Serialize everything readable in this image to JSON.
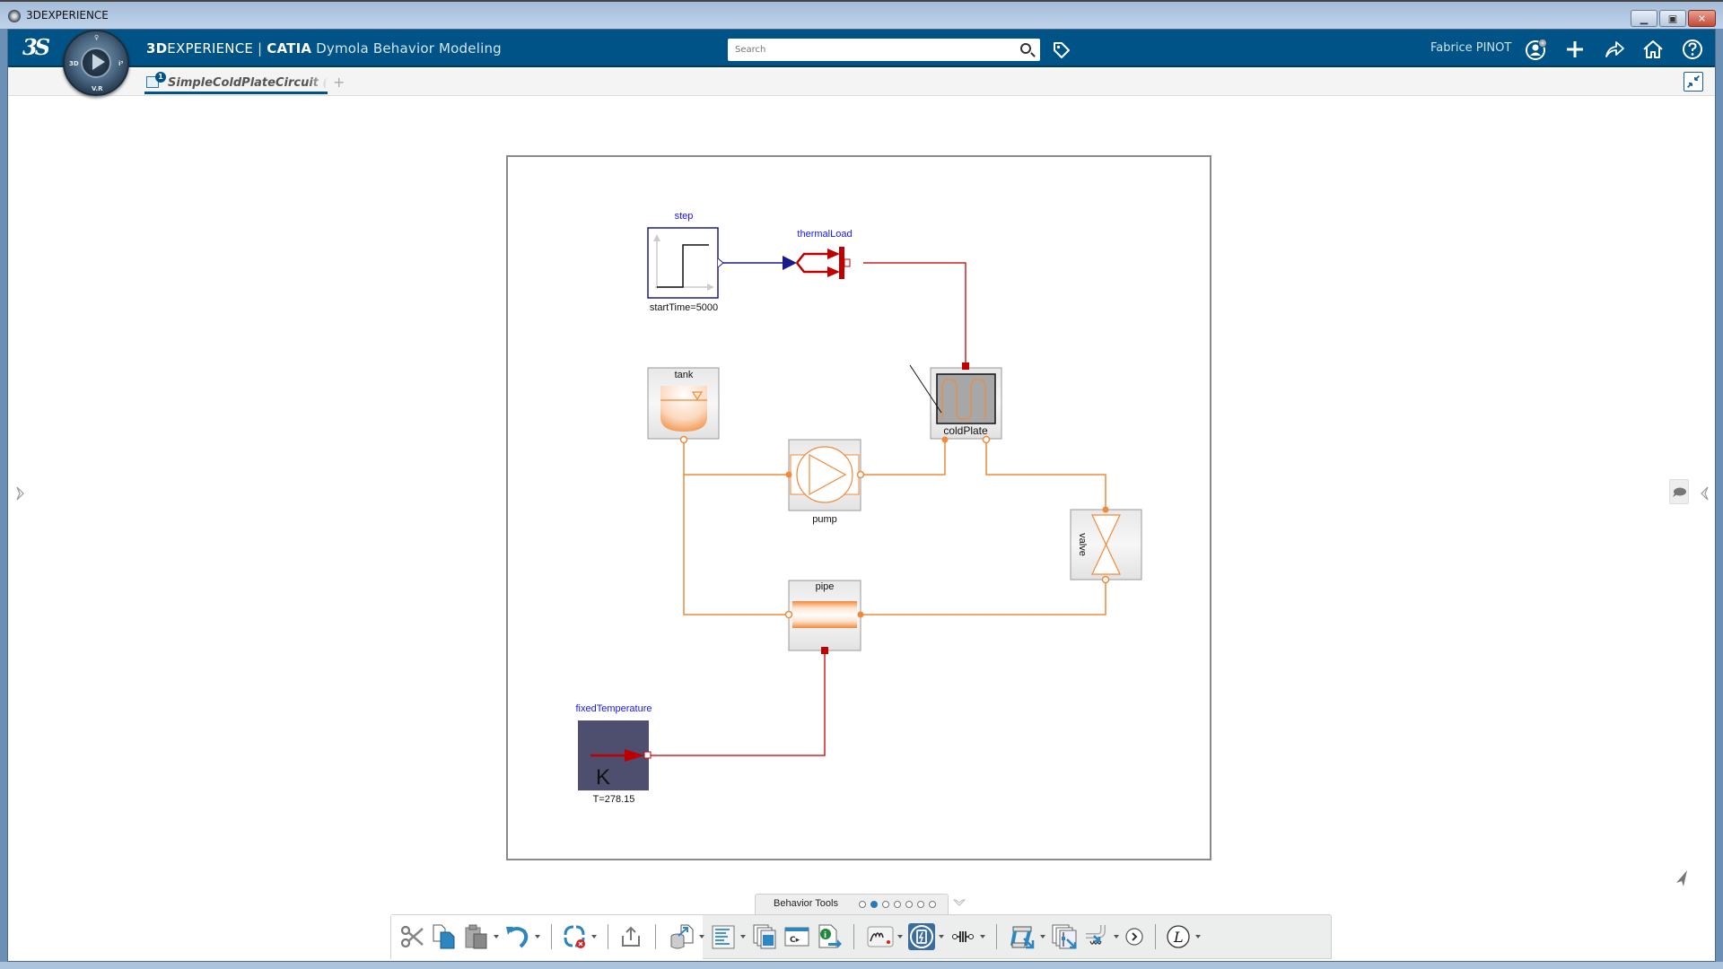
{
  "window": {
    "title": "3DEXPERIENCE",
    "controls": [
      "minimize",
      "maximize",
      "close"
    ]
  },
  "header": {
    "brand_bold": "3D",
    "brand_light": "EXPERIENCE",
    "separator": " | ",
    "product": "CATIA",
    "app_name": "Dymola Behavior Modeling",
    "compass_labels": {
      "top": "♀",
      "left": "3D",
      "right": "i³",
      "bottom": "V.R"
    },
    "search": {
      "placeholder": "Search",
      "value": ""
    },
    "user_name": "Fabrice PINOT",
    "icons": [
      "tag-icon",
      "user-icon",
      "add-icon",
      "share-icon",
      "home-icon",
      "help-icon"
    ]
  },
  "tabs": {
    "active": {
      "label": "SimpleColdPlateCircuit (Enc",
      "badge": "1"
    },
    "add_label": "+"
  },
  "diagram": {
    "components": [
      {
        "id": "step",
        "name": "step",
        "param": "startTime=5000",
        "type": "step-source"
      },
      {
        "id": "thermalLoad",
        "name": "thermalLoad",
        "type": "prescribed-heat-flow"
      },
      {
        "id": "tank",
        "name": "tank",
        "type": "tank"
      },
      {
        "id": "coldPlate",
        "name": "coldPlate",
        "type": "cold-plate"
      },
      {
        "id": "pump",
        "name": "pump",
        "type": "pump"
      },
      {
        "id": "valve",
        "name": "valve",
        "type": "valve"
      },
      {
        "id": "pipe",
        "name": "pipe",
        "type": "pipe"
      },
      {
        "id": "fixedTemperature",
        "name": "fixedTemperature",
        "param": "T=278.15",
        "glyph": "K",
        "type": "fixed-temperature"
      }
    ],
    "colors": {
      "signal": "#1a1a8c",
      "heat": "#c00000",
      "fluid": "#f08a3a",
      "label_name": "#1515ff",
      "fixed_temp_fill": "#4e4e6e"
    }
  },
  "behavior_tools": {
    "label": "Behavior Tools",
    "pages": 7,
    "active_page": 2
  },
  "toolbar": {
    "items": [
      {
        "name": "cut",
        "dropdown": false
      },
      {
        "name": "copy",
        "dropdown": false
      },
      {
        "name": "paste",
        "dropdown": true
      },
      {
        "name": "undo",
        "dropdown": true
      },
      {
        "name": "update",
        "dropdown": true
      },
      {
        "name": "share",
        "dropdown": false
      },
      {
        "name": "export-database",
        "dropdown": true
      },
      {
        "name": "model-browser",
        "dropdown": true
      },
      {
        "name": "copy-images",
        "dropdown": false
      },
      {
        "name": "code-view",
        "dropdown": false
      },
      {
        "name": "info-export",
        "dropdown": false
      },
      {
        "name": "plot-signature",
        "dropdown": true
      },
      {
        "name": "simulation-battery",
        "dropdown": true
      },
      {
        "name": "connector",
        "dropdown": true
      },
      {
        "name": "mechanism",
        "dropdown": true
      },
      {
        "name": "parameter-sheets",
        "dropdown": false
      },
      {
        "name": "piping",
        "dropdown": true
      },
      {
        "name": "more",
        "dropdown": false
      },
      {
        "name": "library",
        "glyph": "L",
        "dropdown": true
      }
    ]
  }
}
